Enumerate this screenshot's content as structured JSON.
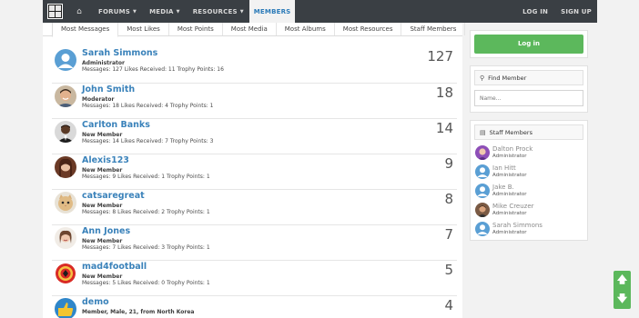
{
  "nav": {
    "items": [
      {
        "label": "FORUMS",
        "caret": true
      },
      {
        "label": "MEDIA",
        "caret": true
      },
      {
        "label": "RESOURCES",
        "caret": true
      },
      {
        "label": "MEMBERS",
        "caret": false,
        "active": true
      }
    ],
    "login": "LOG IN",
    "signup": "SIGN UP"
  },
  "tabs": [
    "Most Messages",
    "Most Likes",
    "Most Points",
    "Most Media",
    "Most Albums",
    "Most Resources",
    "Staff Members"
  ],
  "members": [
    {
      "name": "Sarah Simmons",
      "role": "Administrator",
      "stats": "Messages: 127 Likes Received: 11 Trophy Points: 16",
      "count": "127",
      "avatar": "default-avatar"
    },
    {
      "name": "John Smith",
      "role": "Moderator",
      "stats": "Messages: 18 Likes Received: 4 Trophy Points: 1",
      "count": "18",
      "avatar": "smiling-man-avatar"
    },
    {
      "name": "Carlton Banks",
      "role": "New Member",
      "stats": "Messages: 14 Likes Received: 7 Trophy Points: 3",
      "count": "14",
      "avatar": "man-suit-avatar"
    },
    {
      "name": "Alexis123",
      "role": "New Member",
      "stats": "Messages: 9 Likes Received: 1 Trophy Points: 1",
      "count": "9",
      "avatar": "woman-avatar"
    },
    {
      "name": "catsaregreat",
      "role": "New Member",
      "stats": "Messages: 8 Likes Received: 2 Trophy Points: 1",
      "count": "8",
      "avatar": "cat-avatar"
    },
    {
      "name": "Ann Jones",
      "role": "New Member",
      "stats": "Messages: 7 Likes Received: 3 Trophy Points: 1",
      "count": "7",
      "avatar": "woman-smile-avatar"
    },
    {
      "name": "mad4football",
      "role": "New Member",
      "stats": "Messages: 5 Likes Received: 0 Trophy Points: 1",
      "count": "5",
      "avatar": "football-crest-avatar"
    },
    {
      "name": "demo",
      "role": "Member, Male, 21, from North Korea",
      "stats": "",
      "count": "4",
      "avatar": "thumbs-up-avatar"
    }
  ],
  "sidebar": {
    "login_button": "Log in",
    "find_member": {
      "title": "Find Member",
      "placeholder": "Name..."
    },
    "staff": {
      "title": "Staff Members",
      "items": [
        {
          "name": "Dalton Prock",
          "role": "Administrator",
          "avatar": "purple-avatar"
        },
        {
          "name": "Ian Hitt",
          "role": "Administrator",
          "avatar": "default-avatar"
        },
        {
          "name": "Jake B.",
          "role": "Administrator",
          "avatar": "default-avatar"
        },
        {
          "name": "Mike Creuzer",
          "role": "Administrator",
          "avatar": "photo-avatar"
        },
        {
          "name": "Sarah Simmons",
          "role": "Administrator",
          "avatar": "default-avatar"
        }
      ]
    }
  },
  "colors": {
    "accent": "#3a82ba",
    "nav_bg": "#3a3f44",
    "button_green": "#5cb85c"
  }
}
